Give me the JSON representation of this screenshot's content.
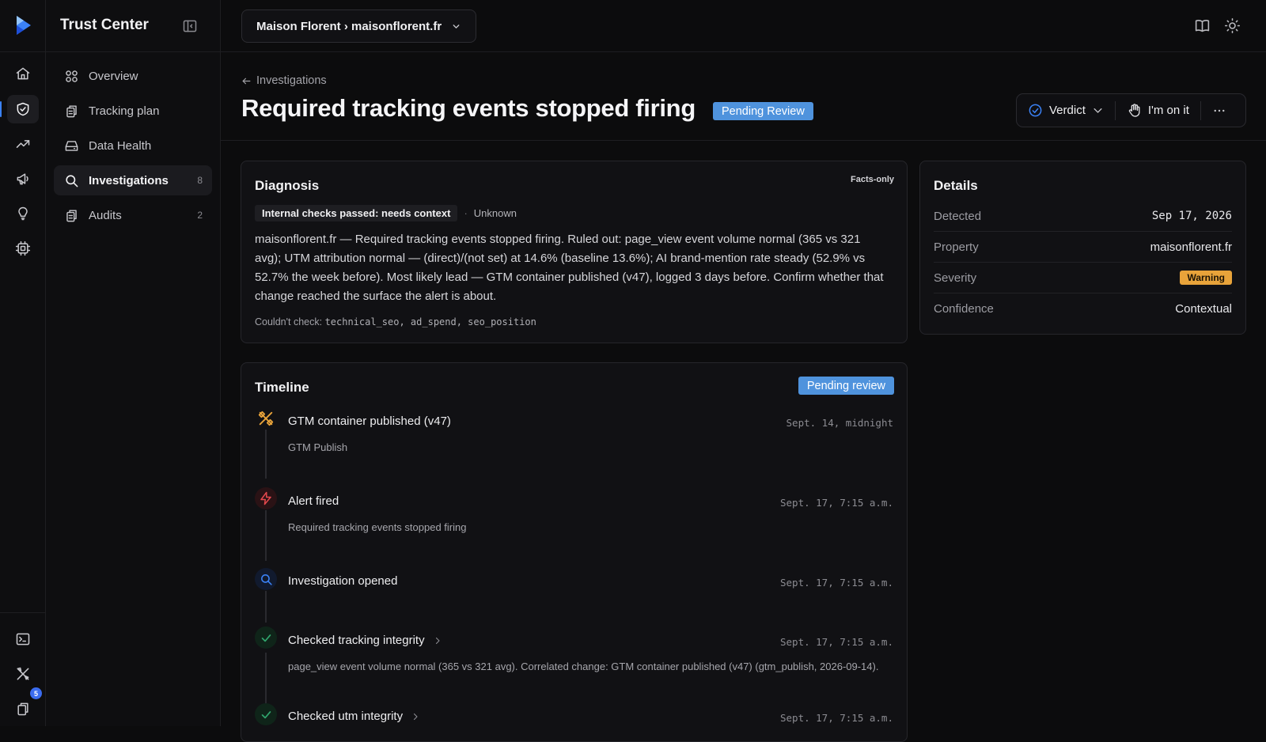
{
  "app": {
    "title": "Trust Center"
  },
  "sidebar": {
    "items": [
      {
        "label": "Overview",
        "icon": "overview-icon"
      },
      {
        "label": "Tracking plan",
        "icon": "clipboard-icon"
      },
      {
        "label": "Data Health",
        "icon": "drive-icon"
      },
      {
        "label": "Investigations",
        "icon": "search-icon",
        "count": "8"
      },
      {
        "label": "Audits",
        "icon": "clipboard-icon",
        "count": "2"
      }
    ]
  },
  "rail": {
    "badge": "5"
  },
  "topbar": {
    "breadcrumb": "Maison Florent › maisonflorent.fr"
  },
  "page": {
    "back_label": "Investigations",
    "title": "Required tracking events stopped firing",
    "status": "Pending Review",
    "actions": {
      "verdict": "Verdict",
      "claim": "I'm on it"
    }
  },
  "diagnosis": {
    "title": "Diagnosis",
    "badge": "Facts-only",
    "tag": "Internal checks passed: needs context",
    "tag_secondary": "Unknown",
    "body": "maisonflorent.fr — Required tracking events stopped firing. Ruled out: page_view event volume normal (365 vs 321 avg); UTM attribution normal — (direct)/(not set) at 14.6% (baseline 13.6%); AI brand-mention rate steady (52.9% vs 52.7% the week before). Most likely lead — GTM container published (v47), logged 3 days before. Confirm whether that change reached the surface the alert is about.",
    "foot_label": "Couldn't check:",
    "foot_items": "technical_seo, ad_spend, seo_position"
  },
  "details": {
    "title": "Details",
    "rows": [
      {
        "label": "Detected",
        "value": "Sep 17, 2026"
      },
      {
        "label": "Property",
        "value": "maisonflorent.fr"
      },
      {
        "label": "Severity",
        "value": "Warning"
      },
      {
        "label": "Confidence",
        "value": "Contextual"
      }
    ]
  },
  "timeline": {
    "title": "Timeline",
    "status": "Pending review",
    "events": [
      {
        "title": "GTM container published (v47)",
        "sub": "GTM Publish",
        "time": "Sept. 14, midnight",
        "icon": "tools-icon",
        "color": "#e8a33a"
      },
      {
        "title": "Alert fired",
        "sub": "Required tracking events stopped firing",
        "time": "Sept. 17, 7:15 a.m.",
        "icon": "lightning-icon",
        "color": "#e5484d"
      },
      {
        "title": "Investigation opened",
        "sub": "",
        "time": "Sept. 17, 7:15 a.m.",
        "icon": "search-icon",
        "color": "#3b82f6"
      },
      {
        "title": "Checked tracking integrity",
        "sub": "page_view event volume normal (365 vs 321 avg). Correlated change: GTM container published (v47) (gtm_publish, 2026-09-14).",
        "time": "Sept. 17, 7:15 a.m.",
        "icon": "check-icon",
        "color": "#30a46c"
      },
      {
        "title": "Checked utm integrity",
        "sub": "",
        "time": "Sept. 17, 7:15 a.m.",
        "icon": "check-icon",
        "color": "#30a46c"
      }
    ]
  }
}
